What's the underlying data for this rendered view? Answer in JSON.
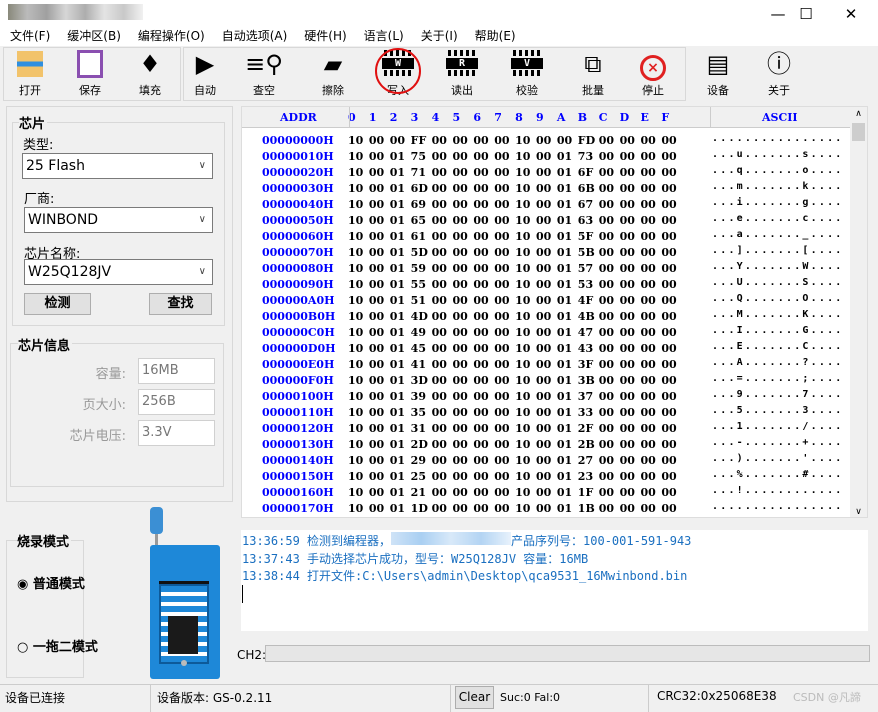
{
  "window": {
    "minimize_icon": "minimize-icon",
    "maximize_icon": "maximize-icon",
    "close_icon": "close-icon"
  },
  "menu": [
    "文件(F)",
    "缓冲区(B)",
    "编程操作(O)",
    "自动选项(A)",
    "硬件(H)",
    "语言(L)",
    "关于(I)",
    "帮助(E)"
  ],
  "toolbar": [
    {
      "label": "打开",
      "icon": "folder-open-icon"
    },
    {
      "label": "保存",
      "icon": "floppy-save-icon"
    },
    {
      "label": "填充",
      "icon": "paint-bucket-icon"
    },
    {
      "label": "自动",
      "icon": "play-icon"
    },
    {
      "label": "查空",
      "icon": "search-blank-icon"
    },
    {
      "label": "擦除",
      "icon": "eraser-icon"
    },
    {
      "label": "写入",
      "icon": "chip-write-icon",
      "chip": "W",
      "highlighted": true
    },
    {
      "label": "读出",
      "icon": "chip-read-icon",
      "chip": "R"
    },
    {
      "label": "校验",
      "icon": "chip-verify-icon",
      "chip": "V"
    },
    {
      "label": "批量",
      "icon": "batch-copy-icon"
    },
    {
      "label": "停止",
      "icon": "stop-icon"
    },
    {
      "label": "设备",
      "icon": "device-icon"
    },
    {
      "label": "关于",
      "icon": "info-icon"
    }
  ],
  "chip_group": {
    "title": "芯片",
    "type_label": "类型:",
    "type_value": "25 Flash",
    "vendor_label": "厂商:",
    "vendor_value": "WINBOND",
    "name_label": "芯片名称:",
    "name_value": "W25Q128JV",
    "detect_button": "检测",
    "find_button": "查找"
  },
  "chip_info": {
    "title": "芯片信息",
    "capacity_label": "容量:",
    "capacity_value": "16MB",
    "page_label": "页大小:",
    "page_value": "256B",
    "voltage_label": "芯片电压:",
    "voltage_value": "3.3V"
  },
  "burn_mode": {
    "title": "烧录模式",
    "normal": "普通模式",
    "one_to_two": "一拖二模式",
    "selected": "普通模式"
  },
  "hex": {
    "addr_header": "ADDR",
    "columns": [
      "0",
      "1",
      "2",
      "3",
      "4",
      "5",
      "6",
      "7",
      "8",
      "9",
      "A",
      "B",
      "C",
      "D",
      "E",
      "F"
    ],
    "ascii_header": "ASCII",
    "rows": [
      {
        "addr": "00000000H",
        "bytes": "10 00 00 FF 00 00 00 00 10 00 00 FD 00 00 00 00",
        "ascii": "................"
      },
      {
        "addr": "00000010H",
        "bytes": "10 00 01 75 00 00 00 00 10 00 01 73 00 00 00 00",
        "ascii": "...u.......s...."
      },
      {
        "addr": "00000020H",
        "bytes": "10 00 01 71 00 00 00 00 10 00 01 6F 00 00 00 00",
        "ascii": "...q.......o...."
      },
      {
        "addr": "00000030H",
        "bytes": "10 00 01 6D 00 00 00 00 10 00 01 6B 00 00 00 00",
        "ascii": "...m.......k...."
      },
      {
        "addr": "00000040H",
        "bytes": "10 00 01 69 00 00 00 00 10 00 01 67 00 00 00 00",
        "ascii": "...i.......g...."
      },
      {
        "addr": "00000050H",
        "bytes": "10 00 01 65 00 00 00 00 10 00 01 63 00 00 00 00",
        "ascii": "...e.......c...."
      },
      {
        "addr": "00000060H",
        "bytes": "10 00 01 61 00 00 00 00 10 00 01 5F 00 00 00 00",
        "ascii": "...a......._...."
      },
      {
        "addr": "00000070H",
        "bytes": "10 00 01 5D 00 00 00 00 10 00 01 5B 00 00 00 00",
        "ascii": "...].......[...."
      },
      {
        "addr": "00000080H",
        "bytes": "10 00 01 59 00 00 00 00 10 00 01 57 00 00 00 00",
        "ascii": "...Y.......W...."
      },
      {
        "addr": "00000090H",
        "bytes": "10 00 01 55 00 00 00 00 10 00 01 53 00 00 00 00",
        "ascii": "...U.......S...."
      },
      {
        "addr": "000000A0H",
        "bytes": "10 00 01 51 00 00 00 00 10 00 01 4F 00 00 00 00",
        "ascii": "...Q.......O...."
      },
      {
        "addr": "000000B0H",
        "bytes": "10 00 01 4D 00 00 00 00 10 00 01 4B 00 00 00 00",
        "ascii": "...M.......K...."
      },
      {
        "addr": "000000C0H",
        "bytes": "10 00 01 49 00 00 00 00 10 00 01 47 00 00 00 00",
        "ascii": "...I.......G...."
      },
      {
        "addr": "000000D0H",
        "bytes": "10 00 01 45 00 00 00 00 10 00 01 43 00 00 00 00",
        "ascii": "...E.......C...."
      },
      {
        "addr": "000000E0H",
        "bytes": "10 00 01 41 00 00 00 00 10 00 01 3F 00 00 00 00",
        "ascii": "...A.......?...."
      },
      {
        "addr": "000000F0H",
        "bytes": "10 00 01 3D 00 00 00 00 10 00 01 3B 00 00 00 00",
        "ascii": "...=.......;...."
      },
      {
        "addr": "00000100H",
        "bytes": "10 00 01 39 00 00 00 00 10 00 01 37 00 00 00 00",
        "ascii": "...9.......7...."
      },
      {
        "addr": "00000110H",
        "bytes": "10 00 01 35 00 00 00 00 10 00 01 33 00 00 00 00",
        "ascii": "...5.......3...."
      },
      {
        "addr": "00000120H",
        "bytes": "10 00 01 31 00 00 00 00 10 00 01 2F 00 00 00 00",
        "ascii": "...1......./...."
      },
      {
        "addr": "00000130H",
        "bytes": "10 00 01 2D 00 00 00 00 10 00 01 2B 00 00 00 00",
        "ascii": "...-.......+...."
      },
      {
        "addr": "00000140H",
        "bytes": "10 00 01 29 00 00 00 00 10 00 01 27 00 00 00 00",
        "ascii": "...).......'...."
      },
      {
        "addr": "00000150H",
        "bytes": "10 00 01 25 00 00 00 00 10 00 01 23 00 00 00 00",
        "ascii": "...%.......#...."
      },
      {
        "addr": "00000160H",
        "bytes": "10 00 01 21 00 00 00 00 10 00 01 1F 00 00 00 00",
        "ascii": "...!............"
      },
      {
        "addr": "00000170H",
        "bytes": "10 00 01 1D 00 00 00 00 10 00 01 1B 00 00 00 00",
        "ascii": "................"
      }
    ]
  },
  "log": [
    "13:36:59 检测到编程器，",
    "产品序列号：100-001-591-943",
    "13:37:43 手动选择芯片成功，型号：W25Q128JV 容量：16MB",
    "13:38:44 打开文件:C:\\Users\\admin\\Desktop\\qca9531_16Mwinbond.bin"
  ],
  "ch2_label": "CH2:",
  "status": {
    "connection": "设备已连接",
    "version": "设备版本:  GS-0.2.11",
    "clear_button": "Clear",
    "counts": "Suc:0  Fal:0",
    "crc": "CRC32:0x25068E38",
    "watermark": "CSDN @凡諦"
  },
  "colors": {
    "address": "#0000ff",
    "log_text": "#1a6fc0",
    "stop": "#e02020",
    "board": "#1e88d8"
  }
}
